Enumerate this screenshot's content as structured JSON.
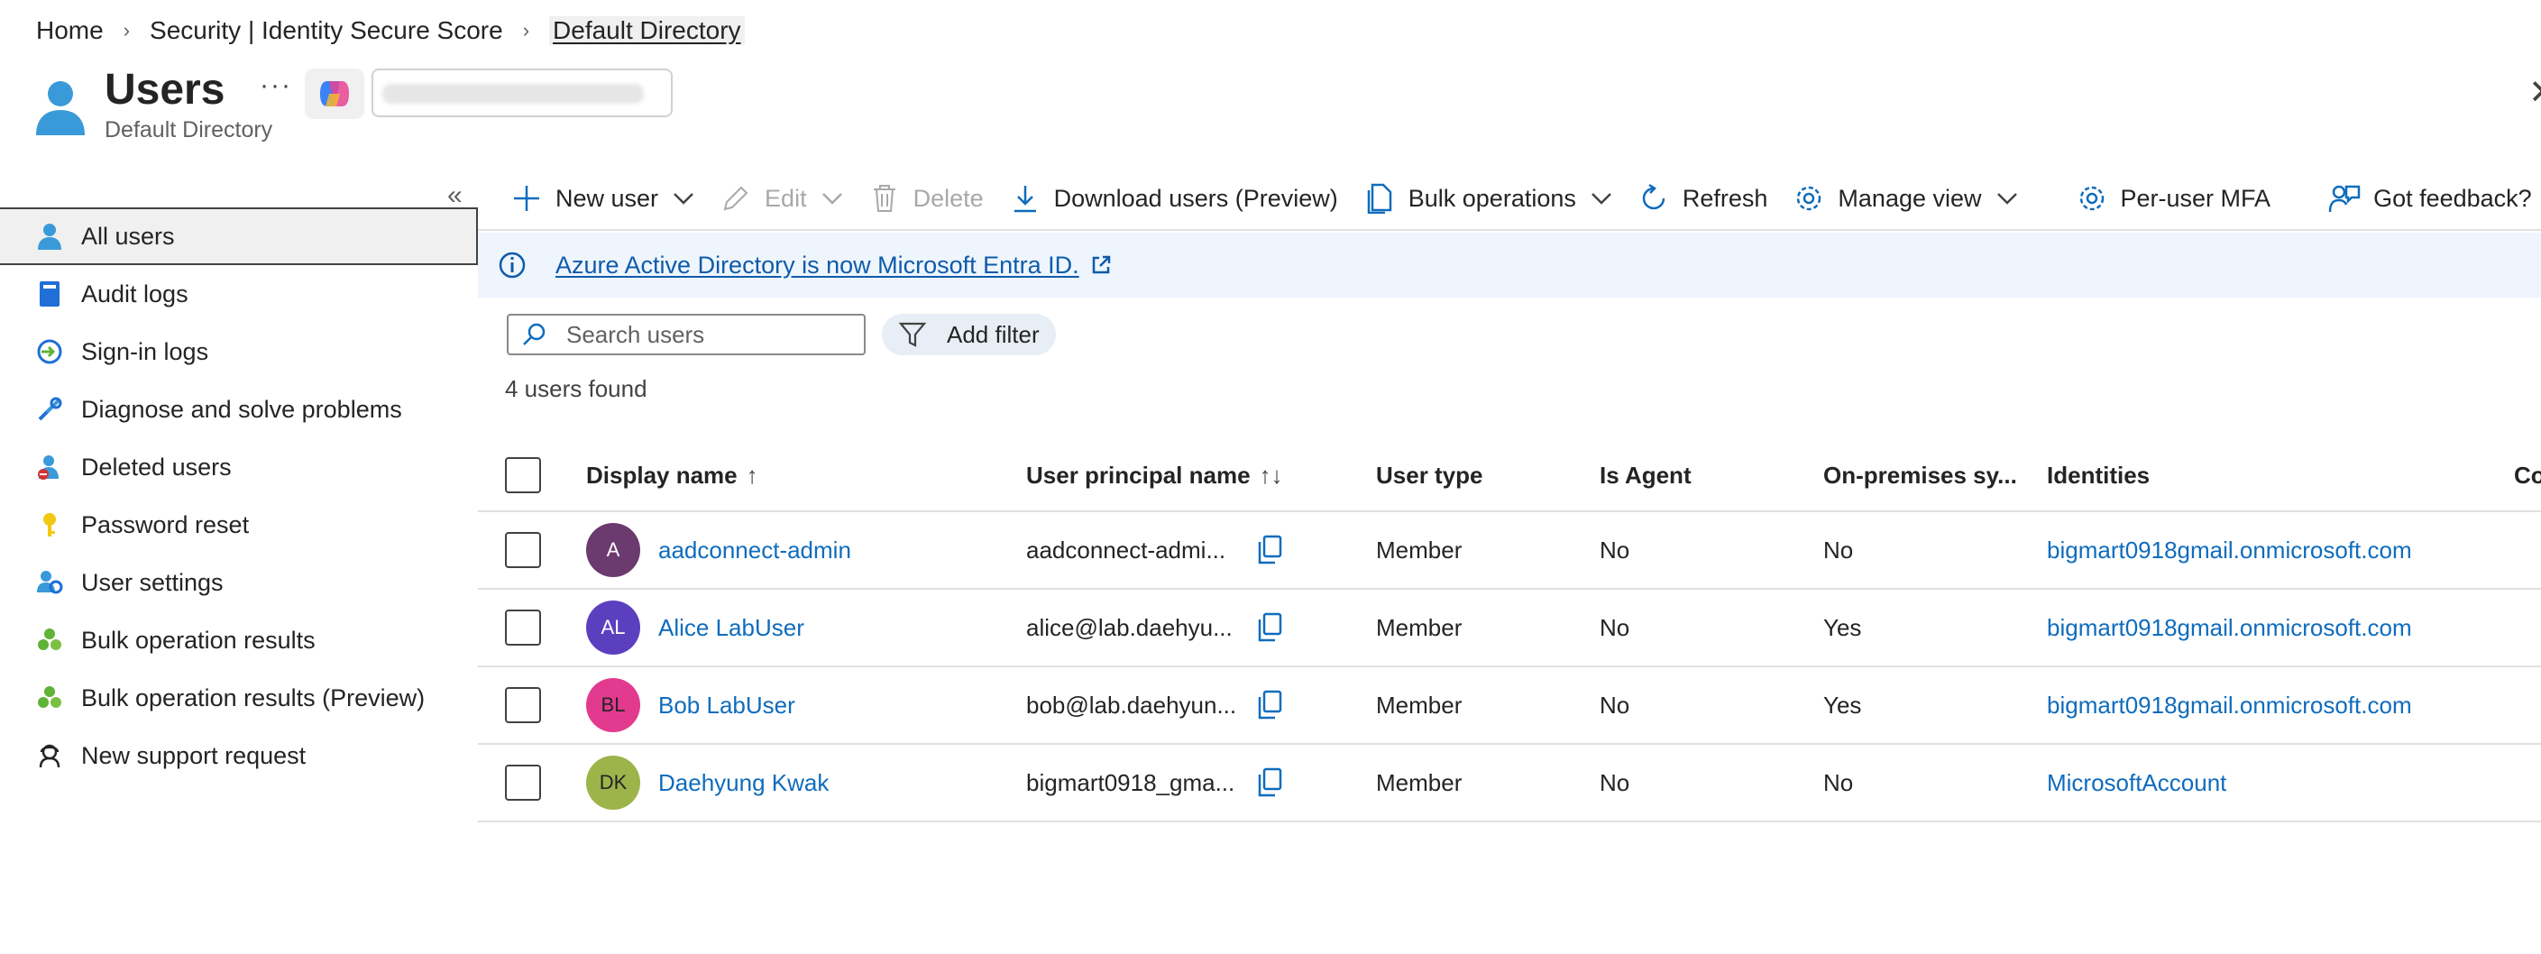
{
  "breadcrumb": {
    "items": [
      "Home",
      "Security | Identity Secure Score",
      "Default Directory"
    ]
  },
  "header": {
    "title": "Users",
    "subtitle": "Default Directory",
    "more": "···"
  },
  "sidebar": {
    "collapse": "«",
    "items": [
      {
        "label": "All users",
        "icon": "user-icon"
      },
      {
        "label": "Audit logs",
        "icon": "book-icon"
      },
      {
        "label": "Sign-in logs",
        "icon": "sign-in-icon"
      },
      {
        "label": "Diagnose and solve problems",
        "icon": "wrench-icon"
      },
      {
        "label": "Deleted users",
        "icon": "deleted-user-icon"
      },
      {
        "label": "Password reset",
        "icon": "key-icon"
      },
      {
        "label": "User settings",
        "icon": "user-settings-icon"
      },
      {
        "label": "Bulk operation results",
        "icon": "bulk-icon"
      },
      {
        "label": "Bulk operation results (Preview)",
        "icon": "bulk-icon"
      },
      {
        "label": "New support request",
        "icon": "support-icon"
      }
    ]
  },
  "toolbar": {
    "new_user": "New user",
    "edit": "Edit",
    "delete": "Delete",
    "download": "Download users (Preview)",
    "bulk": "Bulk operations",
    "refresh": "Refresh",
    "manage_view": "Manage view",
    "per_user_mfa": "Per-user MFA",
    "feedback": "Got feedback?"
  },
  "info": {
    "text": "Azure Active Directory is now Microsoft Entra ID."
  },
  "search": {
    "placeholder": "Search users"
  },
  "filter": {
    "label": "Add filter"
  },
  "results": {
    "count": "4 users found"
  },
  "table": {
    "headers": {
      "display_name": "Display name",
      "display_sort": "↑",
      "upn": "User principal name",
      "upn_sort": "↑↓",
      "user_type": "User type",
      "is_agent": "Is Agent",
      "on_prem": "On-premises sy...",
      "identities": "Identities",
      "next": "Co"
    },
    "rows": [
      {
        "initials": "A",
        "avatar_color": "#6b3a6e",
        "name": "aadconnect-admin",
        "upn": "aadconnect-admi...",
        "type": "Member",
        "agent": "No",
        "onprem": "No",
        "identity": "bigmart0918gmail.onmicrosoft.com"
      },
      {
        "initials": "AL",
        "avatar_color": "#5b3fbf",
        "name": "Alice LabUser",
        "upn": "alice@lab.daehyu...",
        "type": "Member",
        "agent": "No",
        "onprem": "Yes",
        "identity": "bigmart0918gmail.onmicrosoft.com"
      },
      {
        "initials": "BL",
        "avatar_color": "#e23a8f",
        "name": "Bob LabUser",
        "upn": "bob@lab.daehyun...",
        "type": "Member",
        "agent": "No",
        "onprem": "Yes",
        "identity": "bigmart0918gmail.onmicrosoft.com"
      },
      {
        "initials": "DK",
        "avatar_color": "#9db44a",
        "name": "Daehyung Kwak",
        "upn": "bigmart0918_gma...",
        "type": "Member",
        "agent": "No",
        "onprem": "No",
        "identity": "MicrosoftAccount"
      }
    ]
  },
  "colors": {
    "accent": "#0f6cbd",
    "info_bg": "#eef5fd",
    "link": "#0f5bab"
  }
}
